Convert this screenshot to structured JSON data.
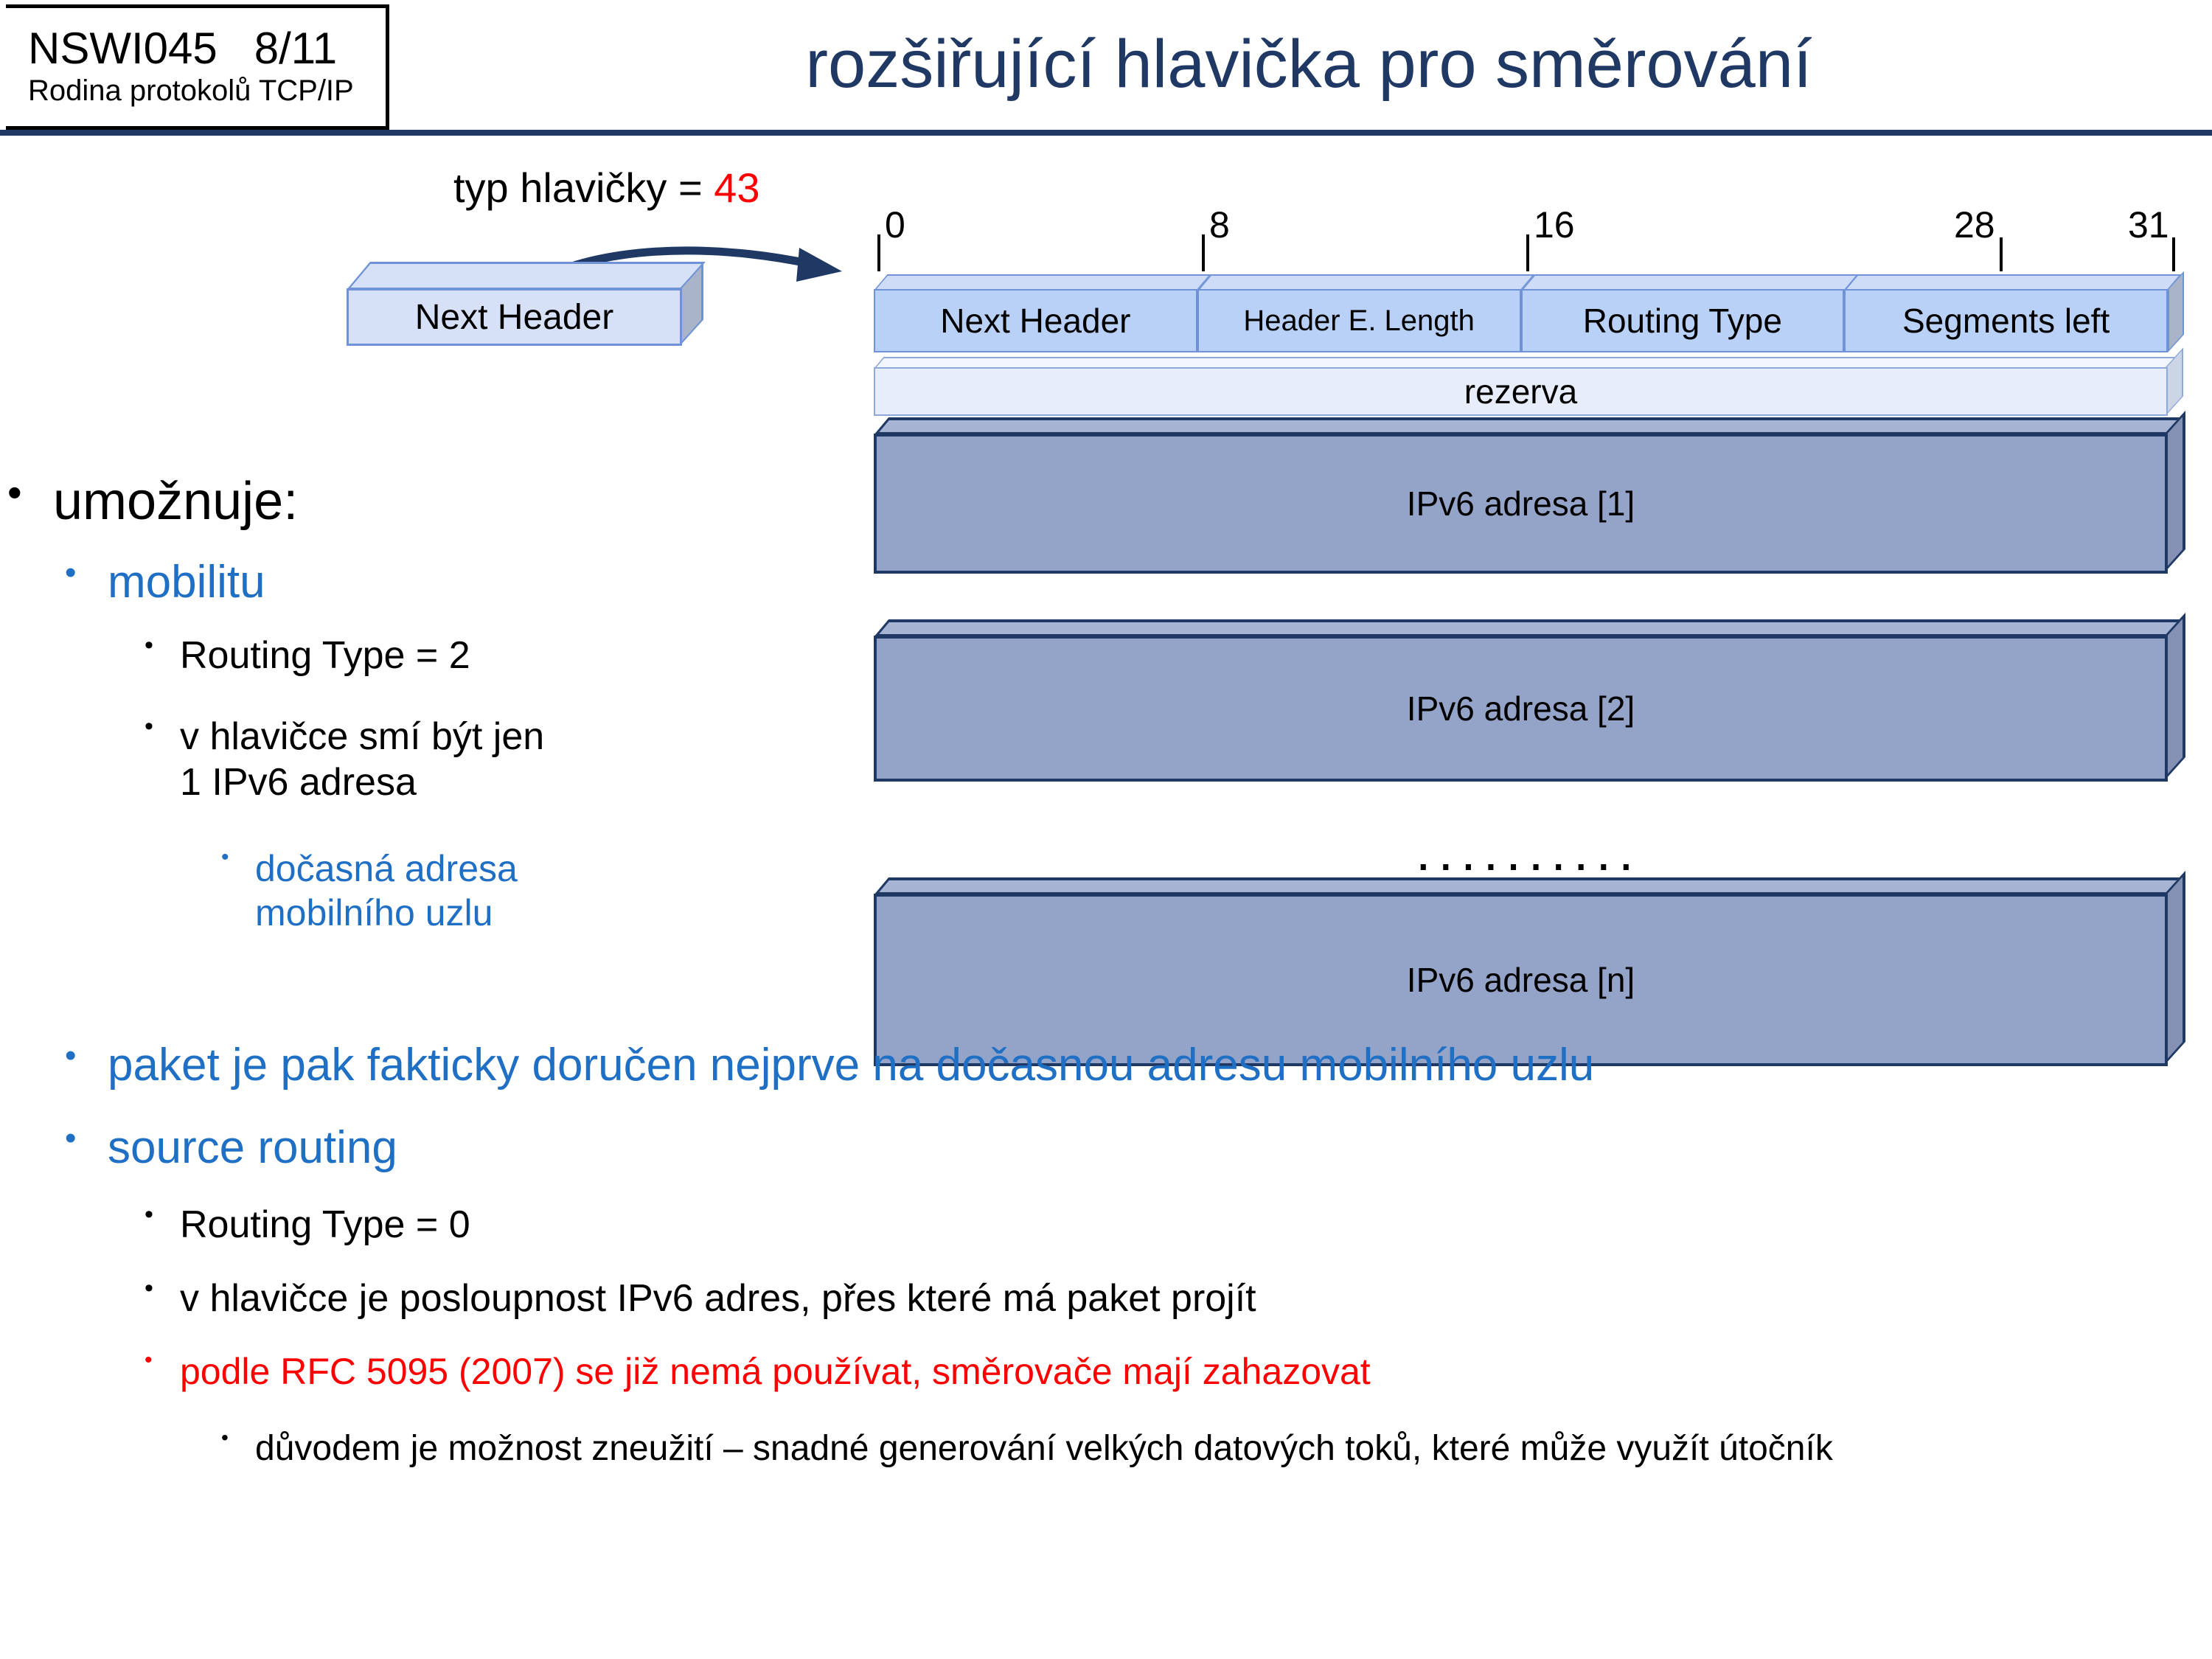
{
  "header": {
    "course_code": "NSWI045   8/11",
    "course_subtitle": "Rodina protokolů TCP/IP",
    "title": "rozšiřující hlavička pro směrování"
  },
  "diagram": {
    "callout_label": "typ hlavičky = ",
    "callout_value": "43",
    "source_box_label": "Next Header",
    "bit_ruler": [
      {
        "label": "0",
        "pos": 0
      },
      {
        "label": "8",
        "pos": 8
      },
      {
        "label": "16",
        "pos": 16
      },
      {
        "label": "28",
        "pos": 28
      },
      {
        "label": "31",
        "pos": 31
      }
    ],
    "header_fields": [
      {
        "label": "Next Header",
        "bits": 8
      },
      {
        "label": "Header E. Length",
        "bits": 8
      },
      {
        "label": "Routing Type",
        "bits": 8
      },
      {
        "label": "Segments left",
        "bits": 8
      }
    ],
    "reserved_label": "rezerva",
    "address_blocks": [
      {
        "label": "IPv6 adresa [1]"
      },
      {
        "label": "IPv6 adresa [2]"
      },
      {
        "label": "IPv6 adresa [n]"
      }
    ],
    "ellipsis": "..........",
    "colors": {
      "field_fill": "#b9d0f7",
      "field_border": "#6f93d6",
      "reserved_fill": "#e7edfa",
      "address_fill": "#94a3c8",
      "address_border": "#1f3864",
      "accent_red": "#ff0000",
      "title_blue": "#1f3864",
      "link_blue": "#1f6fc4"
    }
  },
  "bullets": [
    {
      "level": 1,
      "text": "umožnuje:",
      "color": "black"
    },
    {
      "level": 2,
      "text": "mobilitu",
      "color": "blue"
    },
    {
      "level": 3,
      "text": "Routing Type = 2",
      "color": "dark"
    },
    {
      "level": 3,
      "text": "v hlavičce smí být jen 1 IPv6 adresa",
      "color": "dark"
    },
    {
      "level": 4,
      "text": "dočasná adresa mobilního uzlu",
      "color": "blue"
    },
    {
      "level": 2,
      "text": "paket je pak fakticky doručen nejprve na dočasnou adresu mobilního uzlu",
      "color": "black"
    },
    {
      "level": 2,
      "text": "source routing",
      "color": "blue"
    },
    {
      "level": 3,
      "text": "Routing Type = 0",
      "color": "dark"
    },
    {
      "level": 3,
      "text": "v hlavičce je posloupnost IPv6 adres, přes které má paket projít",
      "color": "dark"
    },
    {
      "level": 3,
      "text": "podle RFC 5095 (2007) se již nemá používat, směrovače mají zahazovat",
      "color": "red"
    },
    {
      "level": 4,
      "text": "důvodem je možnost zneužití – snadné generování velkých datových toků, které může využít útočník",
      "color": "dark"
    }
  ],
  "bullet_glyph": "•"
}
